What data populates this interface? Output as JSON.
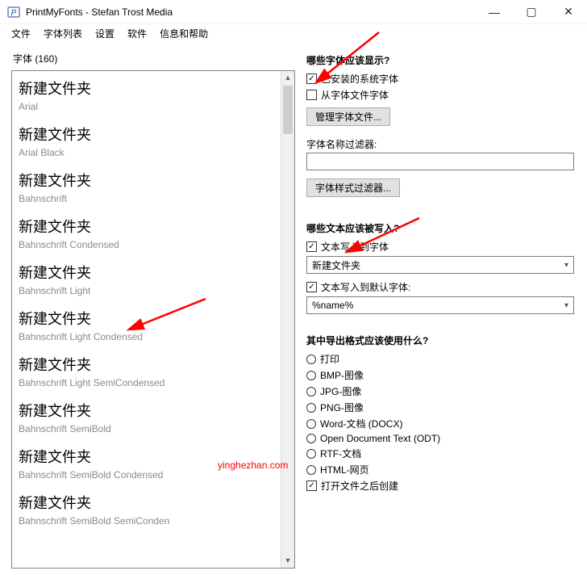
{
  "window": {
    "title": "PrintMyFonts - Stefan Trost Media"
  },
  "menu": {
    "file": "文件",
    "fontlist": "字体列表",
    "settings": "设置",
    "software": "软件",
    "help": "信息和帮助"
  },
  "left": {
    "title": "字体  (160)",
    "items": [
      {
        "sample": "新建文件夹",
        "name": "Arial"
      },
      {
        "sample": "新建文件夹",
        "name": "Arial Black"
      },
      {
        "sample": "新建文件夹",
        "name": "Bahnschrift"
      },
      {
        "sample": "新建文件夹",
        "name": "Bahnschrift Condensed"
      },
      {
        "sample": "新建文件夹",
        "name": "Bahnschrift Light"
      },
      {
        "sample": "新建文件夹",
        "name": "Bahnschrift Light Condensed"
      },
      {
        "sample": "新建文件夹",
        "name": "Bahnschrift Light SemiCondensed"
      },
      {
        "sample": "新建文件夹",
        "name": "Bahnschrift SemiBold"
      },
      {
        "sample": "新建文件夹",
        "name": "Bahnschrift SemiBold Condensed"
      },
      {
        "sample": "新建文件夹",
        "name": "Bahnschrift SemiBold SemiConden"
      }
    ]
  },
  "right": {
    "sec1_title": "哪些字体应该显示?",
    "chk_installed": "已安装的系统字体",
    "chk_fromfile": "从字体文件字体",
    "btn_manage": "管理字体文件...",
    "lbl_namefilter": "字体名称过滤器:",
    "namefilter_value": "",
    "btn_stylefilter": "字体样式过滤器...",
    "sec2_title": "哪些文本应该被写入?",
    "chk_writetofont": "文本写入到字体",
    "combo1_value": "新建文件夹",
    "chk_writetodefault": "文本写入到默认字体:",
    "combo2_value": "%name%",
    "sec3_title": "其中导出格式应该使用什么?",
    "opts": [
      "打印",
      "BMP-图像",
      "JPG-图像",
      "PNG-图像",
      "Word-文档 (DOCX)",
      "Open Document Text (ODT)",
      "RTF-文档",
      "HTML-网页"
    ],
    "chk_openafter": "打开文件之后创建"
  },
  "watermark": "yinghezhan.com"
}
